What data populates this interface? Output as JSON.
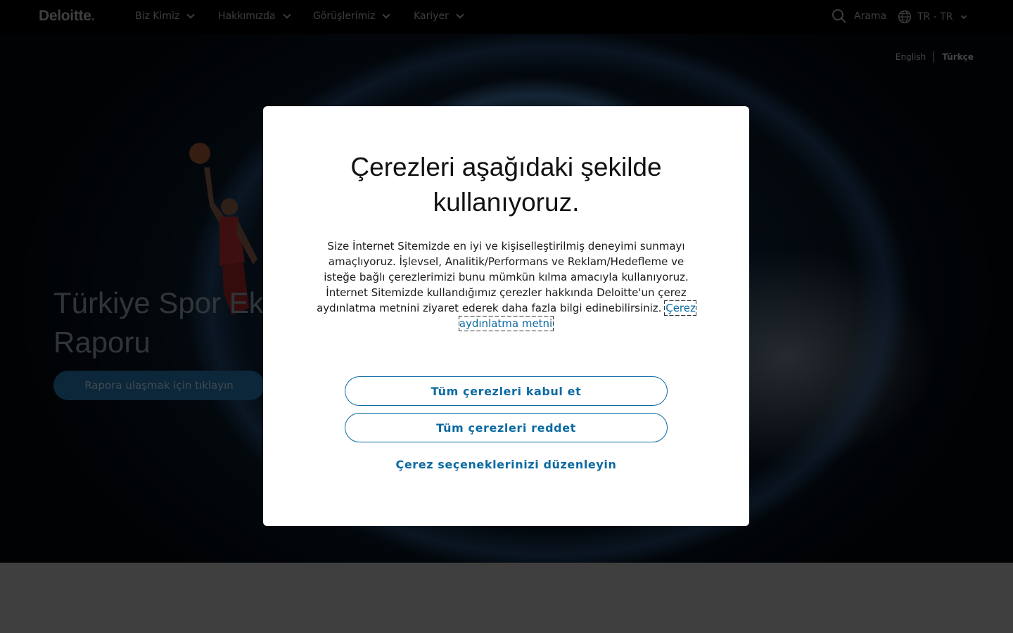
{
  "header": {
    "logo_text": "Deloitte",
    "logo_dot": ".",
    "nav": [
      {
        "label": "Biz Kimiz"
      },
      {
        "label": "Hakkımızda"
      },
      {
        "label": "Görüşlerimiz"
      },
      {
        "label": "Kariyer"
      }
    ],
    "search_label": "Arama",
    "search_icon": "search-icon",
    "locale_label": "TR - TR",
    "locale_icon": "globe-icon"
  },
  "hero": {
    "lang_english": "English",
    "lang_turkish": "Türkçe",
    "title_line1": "Türkiye Spor Eko",
    "title_line2": "Raporu",
    "cta_label": "Rapora ulaşmak için tıklayın"
  },
  "cookie_modal": {
    "title_line1": "Çerezleri aşağıdaki şekilde",
    "title_line2": "kullanıyoruz.",
    "body_text": "Size İnternet Sitemizde en iyi ve kişiselleştirilmiş deneyimi sunmayı amaçlıyoruz. İşlevsel, Analitik/Performans ve Reklam/Hedefleme ve isteğe bağlı çerezlerimizi bunu mümkün kılma amacıyla kullanıyoruz. İnternet Sitemizde kullandığımız çerezler hakkında Deloitte'un çerez aydınlatma metnini ziyaret ederek daha fazla bilgi edinebilirsiniz.",
    "link_text": "Çerez aydınlatma metni",
    "accept_all_label": "Tüm çerezleri kabul et",
    "reject_all_label": "Tüm çerezleri reddet",
    "settings_label": "Çerez seçeneklerinizi düzenleyin"
  },
  "colors": {
    "accent": "#0b6aa2",
    "header_bg": "#000000",
    "cta_bg": "#184f73",
    "lower_bg": "#7f7f7f"
  }
}
